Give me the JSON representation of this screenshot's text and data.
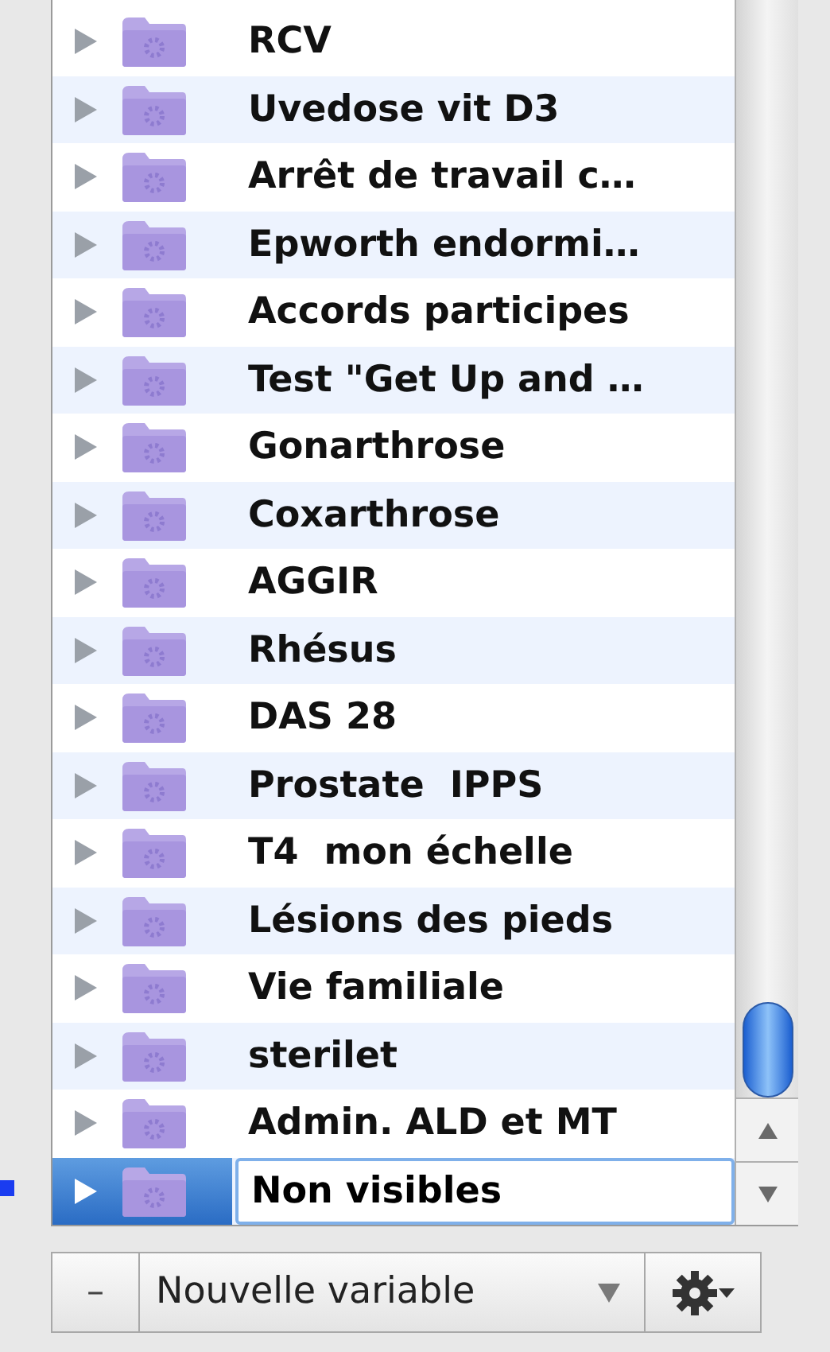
{
  "list": {
    "rows": [
      {
        "label": "RCV",
        "selected": false
      },
      {
        "label": "Uvedose vit D3",
        "selected": false
      },
      {
        "label": "Arrêt de travail c…",
        "selected": false
      },
      {
        "label": "Epworth endormi…",
        "selected": false
      },
      {
        "label": "Accords participes",
        "selected": false
      },
      {
        "label": "Test \"Get Up and …",
        "selected": false
      },
      {
        "label": "Gonarthrose",
        "selected": false
      },
      {
        "label": "Coxarthrose",
        "selected": false
      },
      {
        "label": "AGGIR",
        "selected": false
      },
      {
        "label": "Rhésus",
        "selected": false
      },
      {
        "label": "DAS 28",
        "selected": false
      },
      {
        "label": "Prostate  IPPS",
        "selected": false
      },
      {
        "label": "T4  mon échelle",
        "selected": false
      },
      {
        "label": "Lésions des pieds",
        "selected": false
      },
      {
        "label": "Vie familiale",
        "selected": false
      },
      {
        "label": "sterilet",
        "selected": false
      },
      {
        "label": "Admin. ALD et MT",
        "selected": false
      },
      {
        "label": "Non visibles",
        "selected": true
      }
    ]
  },
  "footer": {
    "remove_button": "–",
    "popup": "Nouvelle variable"
  }
}
